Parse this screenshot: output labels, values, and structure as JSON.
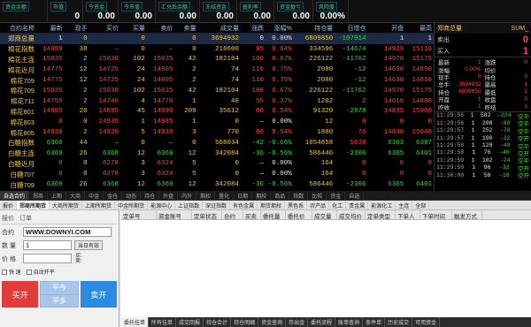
{
  "topbar": [
    {
      "label": "资金余额",
      "value": ""
    },
    {
      "label": "市值",
      "value": "0"
    },
    {
      "label": "今资金",
      "value": "0.00"
    },
    {
      "label": "今市值",
      "value": "0.00"
    },
    {
      "label": "汇兑后余额",
      "value": "0.00"
    },
    {
      "label": "冻结资金",
      "value": "0.00"
    },
    {
      "label": "盈利率",
      "value": "0.00"
    },
    {
      "label": "资金盈亏",
      "value": "0.00"
    },
    {
      "label": "风险度",
      "value": "0.00%"
    }
  ],
  "quote": {
    "headers": [
      "合约名称",
      "最新",
      "现手",
      "买价",
      "买量",
      "卖价",
      "卖量",
      "成交量",
      "涨跌",
      "涨幅%",
      "持仓量",
      "日增仓",
      "开盘",
      "最高"
    ],
    "rows": [
      [
        "郑商总量",
        "1",
        "0",
        "",
        "0",
        "",
        "0",
        "3694932",
        "0",
        "0.00%",
        "6809850",
        "-107914",
        "1",
        "1"
      ],
      [
        "棉花指数",
        "14989",
        "38",
        "—",
        "0",
        "—",
        "0",
        "218600",
        "95",
        "0.64%",
        "334596",
        "-14674",
        "14929",
        "15116"
      ],
      [
        "棉花主连",
        "15035",
        "2",
        "15030",
        "102",
        "15035",
        "42",
        "182104",
        "100",
        "0.67%",
        "226122",
        "-11762",
        "14970",
        "15175"
      ],
      [
        "棉花近月",
        "14775",
        "12",
        "14725",
        "24",
        "14805",
        "2",
        "74",
        "110",
        "0.75%",
        "2080",
        "-12",
        "14630",
        "14850"
      ],
      [
        "棉花709",
        "14775",
        "12",
        "14725",
        "24",
        "14805",
        "2",
        "74",
        "110",
        "0.75%",
        "2080",
        "-12",
        "14630",
        "14850"
      ],
      [
        "棉花709",
        "15035",
        "2",
        "15030",
        "102",
        "15035",
        "42",
        "182104",
        "100",
        "0.67%",
        "226122",
        "-11762",
        "14970",
        "15175"
      ],
      [
        "棉花711",
        "14755",
        "2",
        "14740",
        "4",
        "14770",
        "1",
        "40",
        "55",
        "0.37%",
        "1202",
        "2",
        "14610",
        "14880"
      ],
      [
        "棉花801",
        "14885",
        "20",
        "14885",
        "45",
        "14890",
        "209",
        "35612",
        "80",
        "0.54%",
        "91320",
        "-2978",
        "14835",
        "15000"
      ],
      [
        "棉花803",
        "0",
        "0",
        "14935",
        "1",
        "14985",
        "1",
        "0",
        "—",
        "0.00%",
        "12",
        "0",
        "0",
        "0"
      ],
      [
        "棉花805",
        "14930",
        "2",
        "14920",
        "5",
        "14930",
        "3",
        "770",
        "80",
        "0.54%",
        "1880",
        "76",
        "14840",
        "15040"
      ],
      [
        "白糖指数",
        "6360",
        "44",
        "—",
        "0",
        "—",
        "0",
        "568034",
        "-42",
        "-0.66%",
        "1054858",
        "5038",
        "6363",
        "6397"
      ],
      [
        "白糖主连",
        "6369",
        "26",
        "6368",
        "12",
        "6369",
        "12",
        "342084",
        "-36",
        "-0.56%",
        "586446",
        "-2306",
        "6365",
        "6401"
      ],
      [
        "白糖近月",
        "0",
        "0",
        "6278",
        "3",
        "6324",
        "5",
        "0",
        "—",
        "0.00%",
        "164",
        "0",
        "0",
        "0"
      ],
      [
        "白糖707",
        "0",
        "0",
        "6278",
        "3",
        "6324",
        "5",
        "0",
        "—",
        "0.00%",
        "164",
        "0",
        "0",
        "0"
      ],
      [
        "白糖709",
        "6369",
        "26",
        "6368",
        "12",
        "6369",
        "12",
        "342084",
        "-36",
        "-0.56%",
        "586446",
        "-2306",
        "6365",
        "6401"
      ]
    ]
  },
  "right": {
    "title": "郑商总量",
    "code": "SUM_",
    "sell_label": "卖出",
    "sell_val": "0",
    "buy_label": "买入",
    "buy_val": "1",
    "stats": [
      [
        "最新",
        "1",
        "涨跌",
        "0"
      ],
      [
        "涨幅",
        "0.00%",
        "均价",
        ""
      ],
      [
        "现手",
        "0",
        "持仓",
        "0"
      ],
      [
        "总手",
        "3694932",
        "最高",
        "1"
      ],
      [
        "持仓",
        "6809850",
        "最低",
        "1"
      ],
      [
        "开盘",
        "1",
        "收盘",
        "0"
      ],
      [
        "昨收",
        "1",
        "昨结",
        "1"
      ]
    ],
    "ticks": [
      [
        "11:29:56",
        "1",
        "582",
        "-224",
        "空平"
      ],
      [
        "11:29:56",
        "1",
        "208",
        "-80",
        "空平"
      ],
      [
        "11:29:57",
        "1",
        "252",
        "-76",
        "空平"
      ],
      [
        "11:29:57",
        "1",
        "190",
        "-32",
        "空开"
      ],
      [
        "11:29:58",
        "1",
        "128",
        "-48",
        "空平"
      ],
      [
        "11:29:58",
        "1",
        "76",
        "-40",
        "空开"
      ],
      [
        "11:29:59",
        "1",
        "102",
        "-24",
        "空平"
      ],
      [
        "11:29:59",
        "1",
        "96",
        "-32",
        "空开"
      ],
      [
        "11:30:00",
        "1",
        "58",
        "-16",
        "空开"
      ]
    ]
  },
  "tabs": [
    "自选合约",
    "郑商",
    "上期",
    "大商",
    "中金",
    "金仓",
    "动态",
    "持仓",
    "外盘",
    "内外",
    "期权",
    "量化",
    "日期",
    "期权",
    "商品",
    "指数",
    "比较",
    "资金",
    "自选"
  ],
  "subtabs": [
    "报价",
    "郑商所期货",
    "大商所期货",
    "上期所期货",
    "中金所期货",
    "能源中心",
    "上证指数",
    "深证指数",
    "有色金属",
    "期货期权",
    "黑色系",
    "农产品",
    "化工",
    "贵金属",
    "能源化工",
    "主连",
    "全部"
  ],
  "order": {
    "head1": "报价",
    "head2": "订单",
    "contract_label": "合约",
    "contract_value": "WWW.DOWNYI.COM",
    "qty_label": "数 量",
    "qty_value": "1",
    "qty_hint": "当日有效",
    "price_label": "价 格",
    "buy_hint": "买:",
    "sell_hint": "卖:",
    "chk1": "快 速",
    "chk2": "自动开平",
    "buy_btn": "买开",
    "close_today": "平今",
    "close": "平多",
    "sell_btn": "卖开"
  },
  "table_headers": [
    "定单号",
    "资金账号",
    "定单状态",
    "合约",
    "买卖",
    "委托量",
    "委托价",
    "成交量",
    "成交均价",
    "定单类型",
    "下单人",
    "下单时间",
    "触发方式"
  ],
  "bottom_tabs": [
    "委托挂单",
    "所有挂单",
    "成交回报",
    "持仓合计",
    "持仓明细",
    "资金查询",
    "存出金",
    "委托流程",
    "账单查询",
    "条件单",
    "历史成交",
    "可用资金"
  ]
}
